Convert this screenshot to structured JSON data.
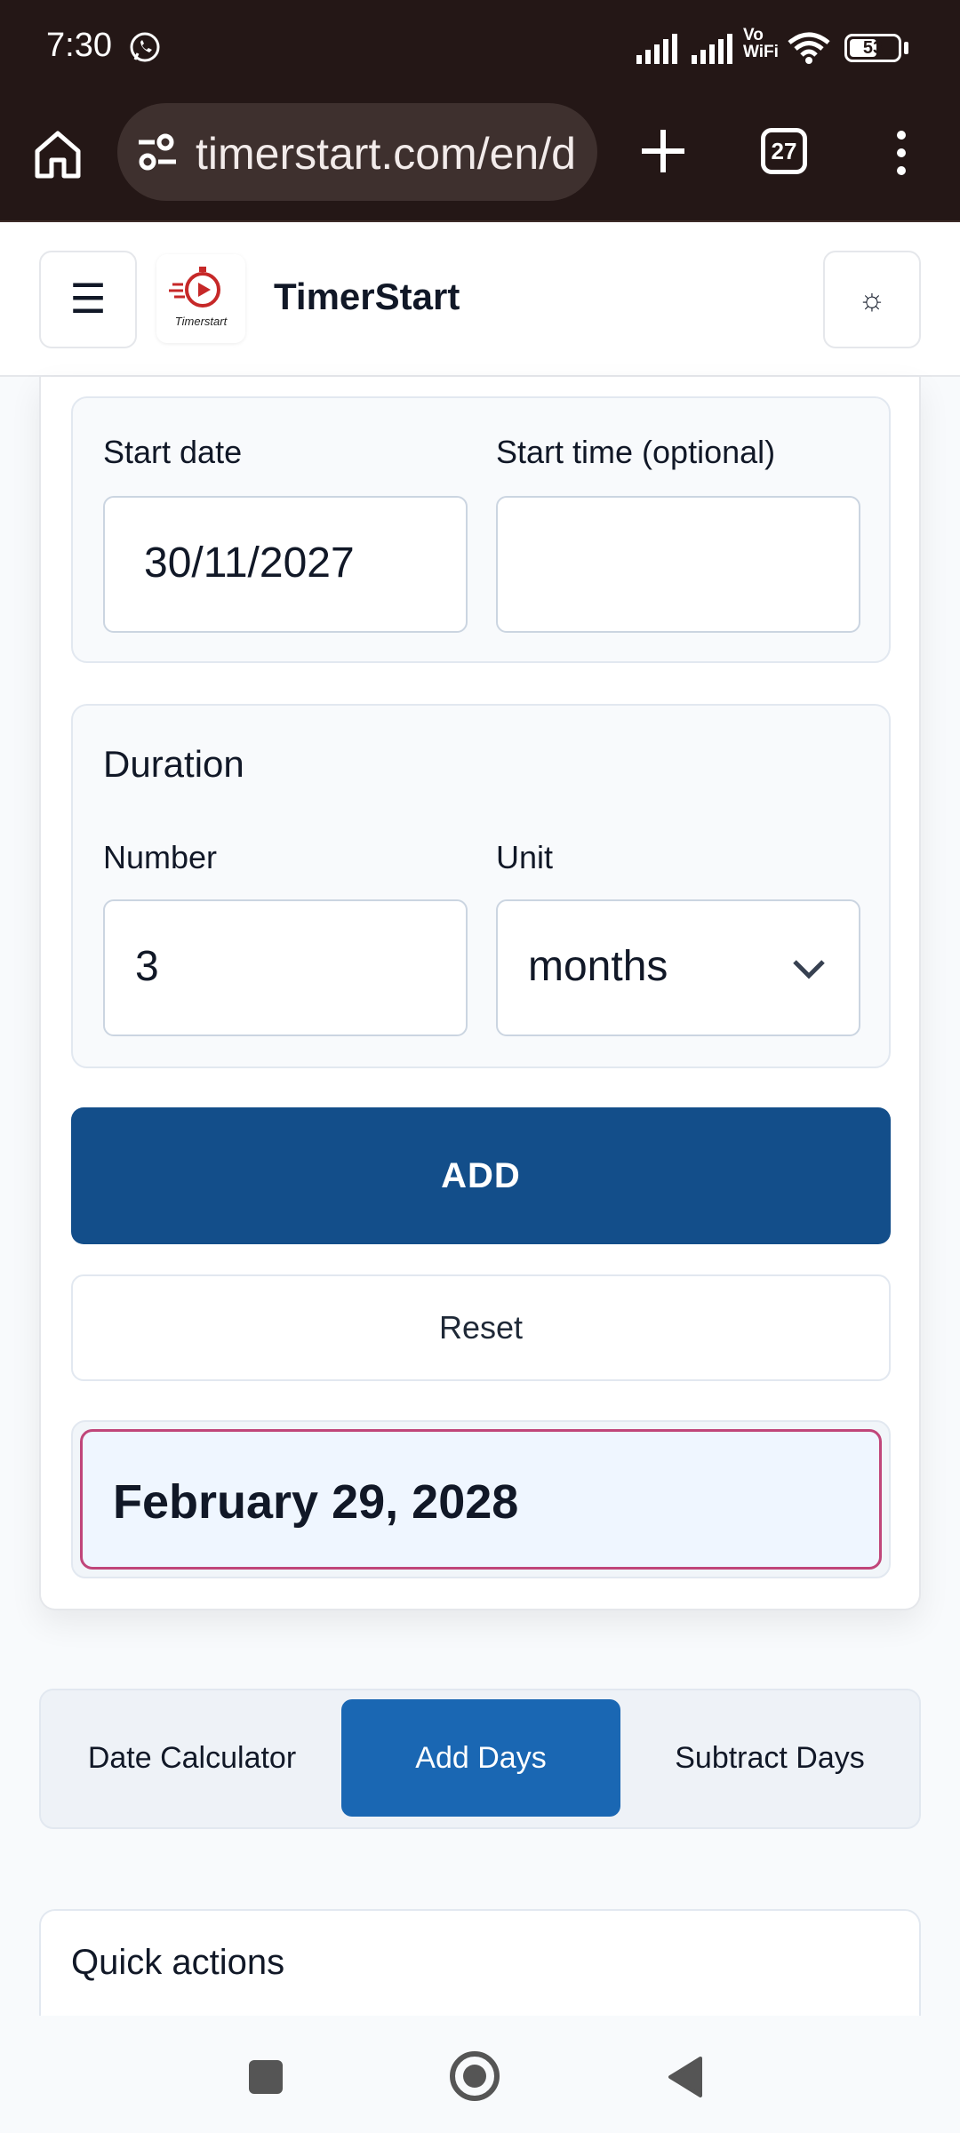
{
  "status_bar": {
    "time": "7:30",
    "vowifi_top": "Vo",
    "vowifi_bottom": "WiFi",
    "battery": "53",
    "icons": [
      "whatsapp-icon",
      "signal-icon",
      "signal-icon",
      "wifi-icon",
      "battery-icon"
    ]
  },
  "browser": {
    "url": "timerstart.com/en/d",
    "tab_count": "27",
    "icons": [
      "home-icon",
      "site-settings-icon",
      "plus-icon",
      "tabs-icon",
      "more-vert-icon"
    ]
  },
  "header": {
    "logo_text": "Timerstart",
    "site_title": "TimerStart",
    "menu_glyph": "☰",
    "theme_glyph": "☼"
  },
  "form": {
    "start_date_label": "Start date",
    "start_date_value": "30/11/2027",
    "start_time_label": "Start time (optional)",
    "start_time_value": "",
    "duration_title": "Duration",
    "number_label": "Number",
    "number_value": "3",
    "unit_label": "Unit",
    "unit_value": "months",
    "add_label": "ADD",
    "reset_label": "Reset"
  },
  "result": {
    "text": "February 29, 2028",
    "border_color": "#c0467a"
  },
  "tabs": [
    {
      "label": "Date Calculator",
      "active": false
    },
    {
      "label": "Add Days",
      "active": true
    },
    {
      "label": "Subtract Days",
      "active": false
    }
  ],
  "quick_actions": {
    "title": "Quick actions"
  },
  "colors": {
    "primary": "#134e8a",
    "tab_active": "#1a67b3",
    "browser_bg": "#241716"
  }
}
